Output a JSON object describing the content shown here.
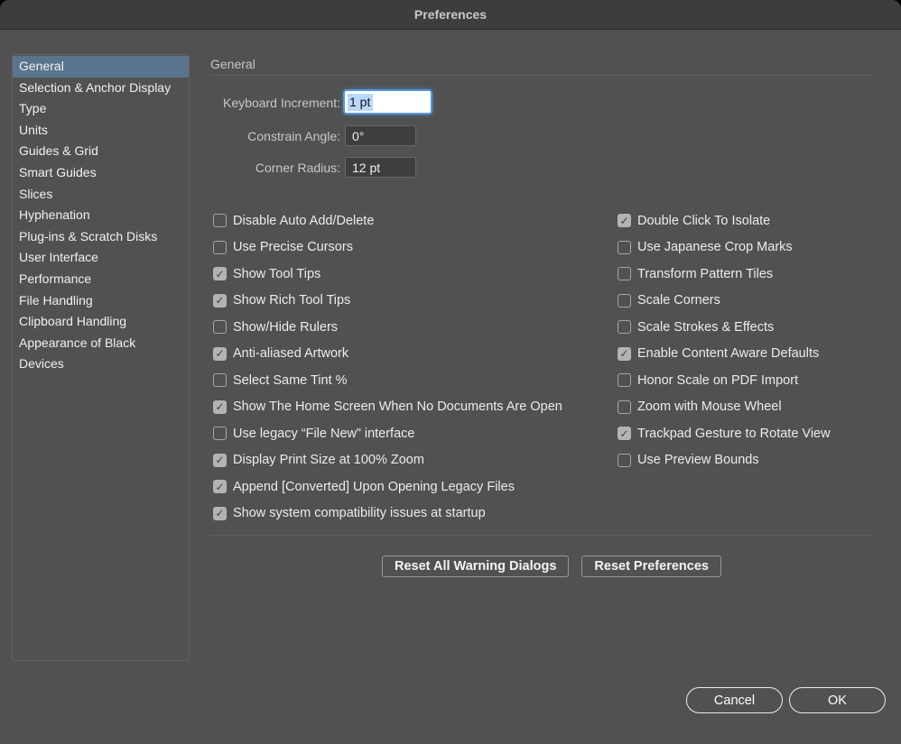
{
  "window": {
    "title": "Preferences"
  },
  "icons": {
    "checkmark": "✓"
  },
  "colors": {
    "dialog_bg": "#515151",
    "titlebar_bg": "#3d3d3d",
    "sidebar_selected_bg": "#59748c",
    "focus_ring": "#5598dd",
    "text_selection_bg": "#b9d8fb",
    "checked_box_fill": "#b3b3b3"
  },
  "sidebar": {
    "items": [
      {
        "label": "General",
        "selected": true
      },
      {
        "label": "Selection & Anchor Display",
        "selected": false
      },
      {
        "label": "Type",
        "selected": false
      },
      {
        "label": "Units",
        "selected": false
      },
      {
        "label": "Guides & Grid",
        "selected": false
      },
      {
        "label": "Smart Guides",
        "selected": false
      },
      {
        "label": "Slices",
        "selected": false
      },
      {
        "label": "Hyphenation",
        "selected": false
      },
      {
        "label": "Plug-ins & Scratch Disks",
        "selected": false
      },
      {
        "label": "User Interface",
        "selected": false
      },
      {
        "label": "Performance",
        "selected": false
      },
      {
        "label": "File Handling",
        "selected": false
      },
      {
        "label": "Clipboard Handling",
        "selected": false
      },
      {
        "label": "Appearance of Black",
        "selected": false
      },
      {
        "label": "Devices",
        "selected": false
      }
    ]
  },
  "content": {
    "heading": "General",
    "fields": [
      {
        "label": "Keyboard Increment:",
        "value": "1 pt",
        "focused": true,
        "text_selected": true
      },
      {
        "label": "Constrain Angle:",
        "value": "0°",
        "focused": false,
        "text_selected": false
      },
      {
        "label": "Corner Radius:",
        "value": "12 pt",
        "focused": false,
        "text_selected": false
      }
    ],
    "checkboxes_left": [
      {
        "label": "Disable Auto Add/Delete",
        "checked": false
      },
      {
        "label": "Use Precise Cursors",
        "checked": false
      },
      {
        "label": "Show Tool Tips",
        "checked": true
      },
      {
        "label": "Show Rich Tool Tips",
        "checked": true
      },
      {
        "label": "Show/Hide Rulers",
        "checked": false
      },
      {
        "label": "Anti-aliased Artwork",
        "checked": true
      },
      {
        "label": "Select Same Tint %",
        "checked": false
      },
      {
        "label": "Show The Home Screen When No Documents Are Open",
        "checked": true
      },
      {
        "label": "Use legacy “File New” interface",
        "checked": false
      },
      {
        "label": "Display Print Size at 100% Zoom",
        "checked": true
      },
      {
        "label": "Append [Converted] Upon Opening Legacy Files",
        "checked": true
      },
      {
        "label": "Show system compatibility issues at startup",
        "checked": true
      }
    ],
    "checkboxes_right": [
      {
        "label": "Double Click To Isolate",
        "checked": true
      },
      {
        "label": "Use Japanese Crop Marks",
        "checked": false
      },
      {
        "label": "Transform Pattern Tiles",
        "checked": false
      },
      {
        "label": "Scale Corners",
        "checked": false
      },
      {
        "label": "Scale Strokes & Effects",
        "checked": false
      },
      {
        "label": "Enable Content Aware Defaults",
        "checked": true
      },
      {
        "label": "Honor Scale on PDF Import",
        "checked": false
      },
      {
        "label": "Zoom with Mouse Wheel",
        "checked": false
      },
      {
        "label": "Trackpad Gesture to Rotate View",
        "checked": true
      },
      {
        "label": "Use Preview Bounds",
        "checked": false
      }
    ],
    "reset_buttons": {
      "reset_warnings_label": "Reset All Warning Dialogs",
      "reset_preferences_label": "Reset Preferences"
    }
  },
  "footer": {
    "cancel_label": "Cancel",
    "ok_label": "OK"
  }
}
